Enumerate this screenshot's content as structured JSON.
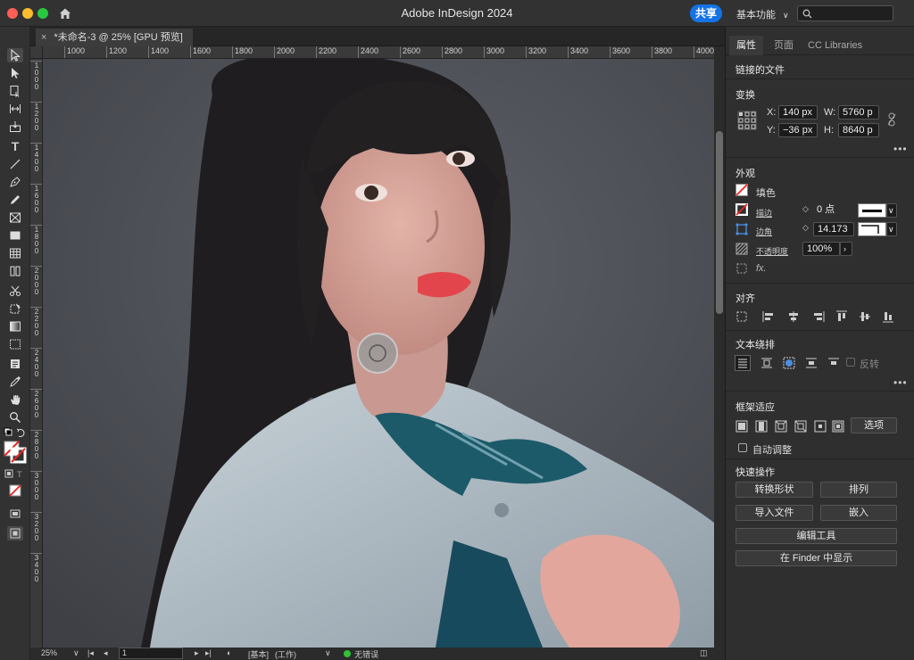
{
  "window": {
    "title": "Adobe InDesign 2024"
  },
  "header": {
    "share_label": "共享",
    "workspace_label": "基本功能",
    "workspace_chevron": "∨"
  },
  "document": {
    "tab_title": "*未命名-3 @ 25% [GPU 预览]",
    "close_glyph": "×"
  },
  "hruler": [
    "1000",
    "1200",
    "1400",
    "1600",
    "1800",
    "2000",
    "2200",
    "2400",
    "2600",
    "2800",
    "3000",
    "3200",
    "3400",
    "3600",
    "3800",
    "4000"
  ],
  "vruler": [
    "1000",
    "1200",
    "1400",
    "1600",
    "1800",
    "2000",
    "2200",
    "2400",
    "2600",
    "2800",
    "3000",
    "3200",
    "3400"
  ],
  "status": {
    "zoom": "25%",
    "page": "1",
    "master": "[基本]",
    "workspace": "(工作)",
    "errors": "无错误"
  },
  "panel": {
    "tabs": [
      "属性",
      "页面",
      "CC Libraries"
    ],
    "linked_file": "链接的文件",
    "transform": {
      "title": "变换",
      "x_label": "X:",
      "x_value": "140 px",
      "y_label": "Y:",
      "y_value": "−36 px",
      "w_label": "W:",
      "w_value": "5760 p",
      "h_label": "H:",
      "h_value": "8640 p"
    },
    "appearance": {
      "title": "外观",
      "fill_label": "填色",
      "stroke_label": "描边",
      "stroke_value": "0 点",
      "corner_label": "边角",
      "corner_value": "14.173",
      "opacity_label": "不透明度",
      "opacity_value": "100%",
      "fx_label": "fx."
    },
    "align": {
      "title": "对齐"
    },
    "text_wrap": {
      "title": "文本绕排",
      "invert_label": "反转"
    },
    "frame_fit": {
      "title": "框架适应",
      "options_label": "选项",
      "auto_fit_label": "自动调整"
    },
    "quick_actions": {
      "title": "快速操作",
      "convert_shape": "转换形状",
      "arrange": "排列",
      "import_file": "导入文件",
      "embed": "嵌入",
      "edit_tool": "编辑工具",
      "show_in_finder": "在 Finder 中显示"
    },
    "more_glyph": "•••"
  },
  "colors": {
    "accent": "#1473e6",
    "status_ok": "#31c136",
    "panel_bg": "#2f2f2f",
    "canvas_bg": "#4a4a4a"
  }
}
